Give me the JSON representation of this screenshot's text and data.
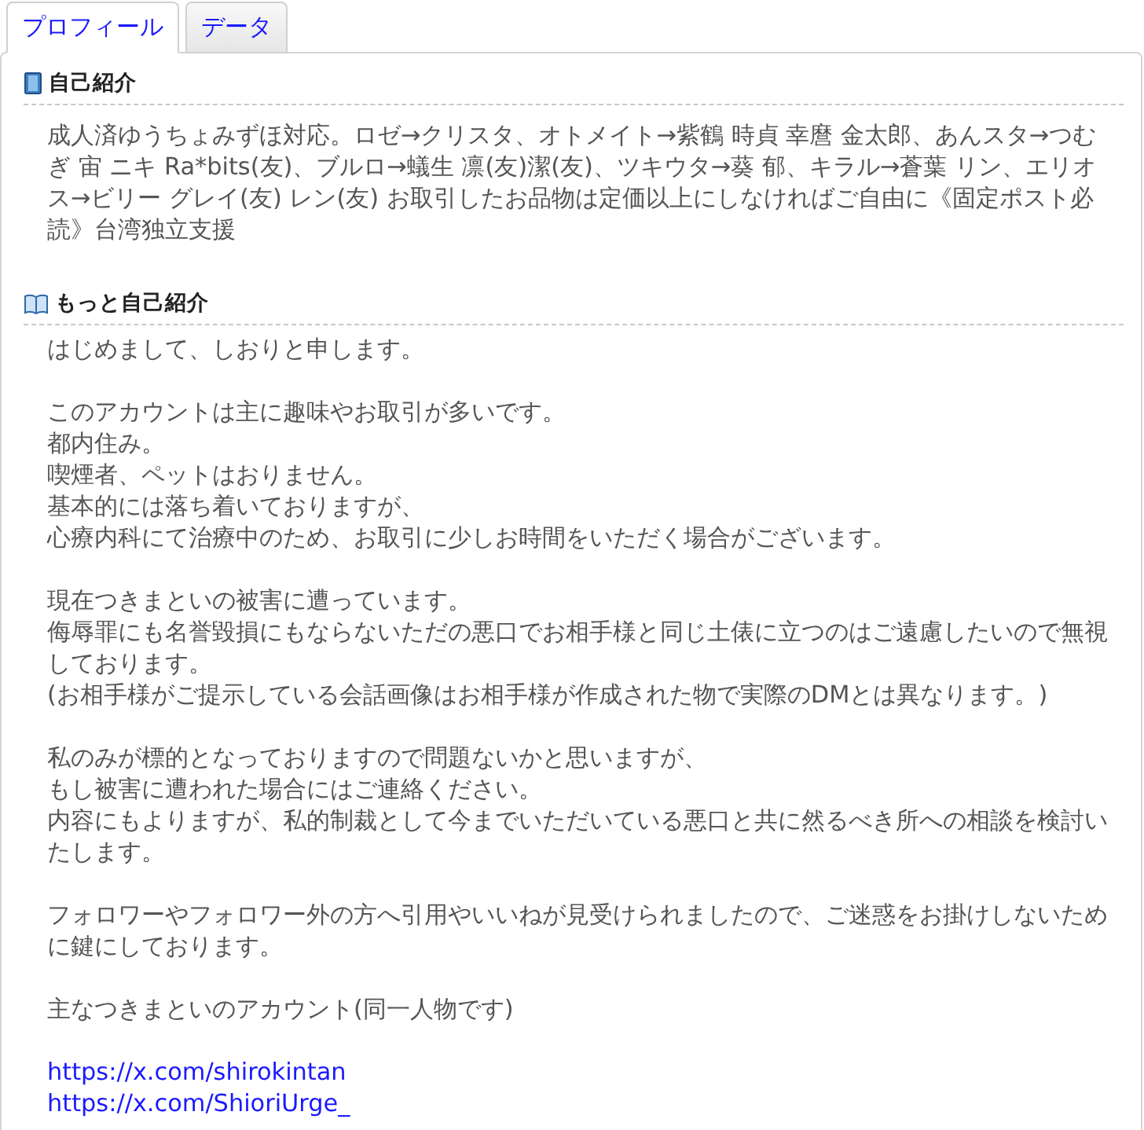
{
  "tabs": [
    {
      "label": "プロフィール",
      "selected": true
    },
    {
      "label": "データ",
      "selected": false
    }
  ],
  "sections": [
    {
      "title": "自己紹介",
      "paragraphs": [
        [
          "成人済ゆうちょみずほ対応。ロゼ→クリスタ、オトメイト→紫鶴 時貞 幸麿 金太郎、あんスタ→つむぎ 宙 ニキ Ra*bits(友)、ブルロ→蟻生 凛(友)潔(友)、ツキウタ→葵 郁、キラル→蒼葉 リン、エリオス→ビリー グレイ(友) レン(友) お取引したお品物は定価以上にしなければご自由に《固定ポスト必読》台湾独立支援"
        ]
      ]
    },
    {
      "title": "もっと自己紹介",
      "paragraphs": [
        [
          "はじめまして、しおりと申します。"
        ],
        [
          "このアカウントは主に趣味やお取引が多いです。",
          "都内住み。",
          "喫煙者、ペットはおりません。",
          "基本的には落ち着いておりますが、",
          "心療内科にて治療中のため、お取引に少しお時間をいただく場合がございます。"
        ],
        [
          "現在つきまといの被害に遭っています。",
          "侮辱罪にも名誉毀損にもならないただの悪口でお相手様と同じ土俵に立つのはご遠慮したいので無視しております。",
          "(お相手様がご提示している会話画像はお相手様が作成された物で実際のDMとは異なります。)"
        ],
        [
          "私のみが標的となっておりますので問題ないかと思いますが、",
          "もし被害に遭われた場合にはご連絡ください。",
          "内容にもよりますが、私的制裁として今までいただいている悪口と共に然るべき所への相談を検討いたします。"
        ],
        [
          "フォロワーやフォロワー外の方へ引用やいいねが見受けられましたので、ご迷惑をお掛けしないために鍵にしております。"
        ],
        [
          "主なつきまといのアカウント(同一人物です)"
        ]
      ],
      "links": [
        "https://x.com/shirokintan",
        "https://x.com/ShioriUrge_"
      ]
    }
  ]
}
